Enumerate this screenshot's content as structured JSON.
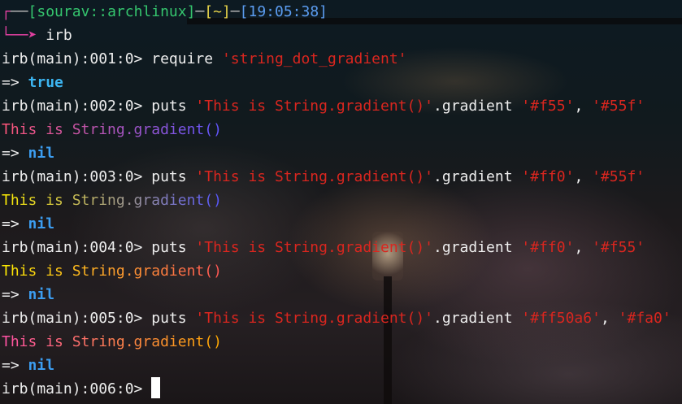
{
  "prompt": {
    "corner_top": "┌",
    "dash1": "──",
    "user_host": "[sourav::archlinux]",
    "dash2": "─",
    "dir": "[~]",
    "dash3": "─",
    "time": "[19:05:38]",
    "corner_bottom": "└",
    "arrow": "──➤",
    "command": "irb"
  },
  "lines": [
    {
      "prompt": "irb(main):001:0> ",
      "method": "require ",
      "string": "'string_dot_gradient'"
    },
    {
      "result_arrow": "=> ",
      "result": "true"
    },
    {
      "prompt": "irb(main):002:0> ",
      "method": "puts ",
      "string": "'This is String.gradient()'",
      "call": ".gradient ",
      "arg1": "'#f55'",
      "sep": ", ",
      "arg2": "'#55f'"
    },
    {
      "output": "This is String.gradient()"
    },
    {
      "result_arrow": "=> ",
      "result": "nil"
    },
    {
      "prompt": "irb(main):003:0> ",
      "method": "puts ",
      "string": "'This is String.gradient()'",
      "call": ".gradient ",
      "arg1": "'#ff0'",
      "sep": ", ",
      "arg2": "'#55f'"
    },
    {
      "output": "This is String.gradient()"
    },
    {
      "result_arrow": "=> ",
      "result": "nil"
    },
    {
      "prompt": "irb(main):004:0> ",
      "method": "puts ",
      "string": "'This is String.gradient()'",
      "call": ".gradient ",
      "arg1": "'#ff0'",
      "sep": ", ",
      "arg2": "'#f55'"
    },
    {
      "output": "This is String.gradient()"
    },
    {
      "result_arrow": "=> ",
      "result": "nil"
    },
    {
      "prompt": "irb(main):005:0> ",
      "method": "puts ",
      "string": "'This is String.gradient()'",
      "call": ".gradient ",
      "arg1": "'#ff50a6'",
      "sep": ", ",
      "arg2": "'#fa0'"
    },
    {
      "output": "This is String.gradient()"
    },
    {
      "result_arrow": "=> ",
      "result": "nil"
    },
    {
      "prompt": "irb(main):006:0> "
    }
  ],
  "colors": {
    "prompt_corner": "#e040a0",
    "user_host": "#35c56e",
    "dir": "#e8d44a",
    "time": "#5b9cf0",
    "string_literal": "#d9261f",
    "true_value": "#3cb4f0",
    "nil_value": "#3c9df0"
  }
}
